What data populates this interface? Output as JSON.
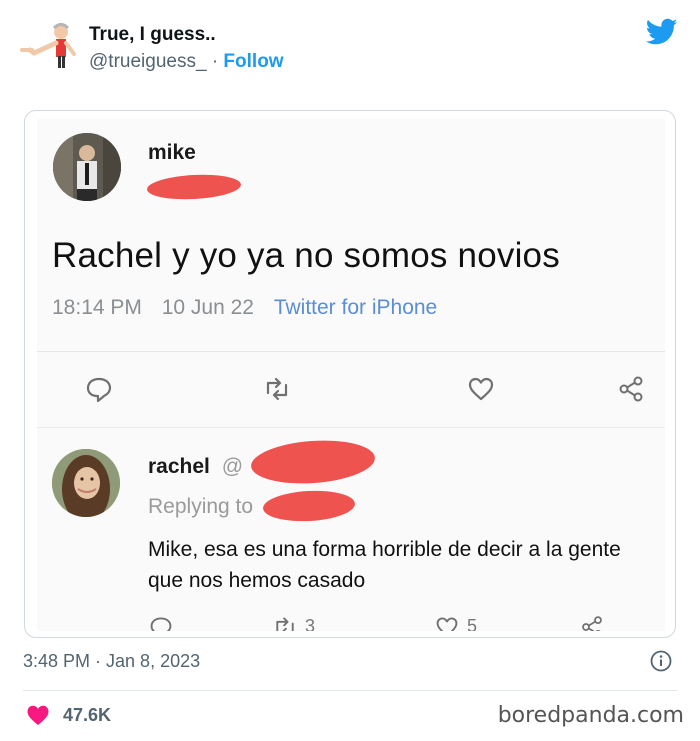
{
  "author": {
    "name": "True, I guess..",
    "handle": "@trueiguess_",
    "separator": "·",
    "follow_label": "Follow"
  },
  "embedded_tweet": {
    "username": "mike",
    "text": "Rachel y yo ya no somos novios",
    "time": "18:14 PM",
    "date": "10 Jun 22",
    "source": "Twitter for iPhone"
  },
  "reply": {
    "username": "rachel",
    "handle_prefix": "@",
    "replying_prefix": "Replying to",
    "text": "Mike, esa es una forma horrible de decir a la gente que nos hemos casado",
    "retweets": "3",
    "likes": "5"
  },
  "footer": {
    "timestamp": "3:48 PM · Jan 8, 2023",
    "like_count": "47.6K",
    "watermark": "boredpanda.com"
  },
  "colors": {
    "twitter_blue": "#1d9bf0",
    "redaction": "#ef5350",
    "heart": "#f91880"
  }
}
